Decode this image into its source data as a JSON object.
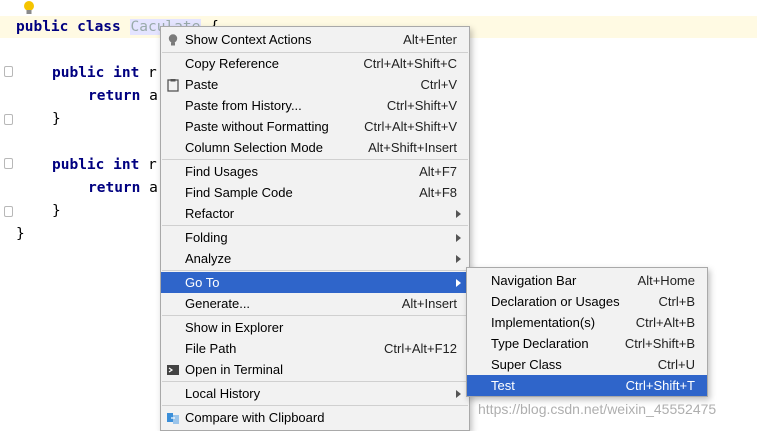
{
  "editor": {
    "lines": [
      {
        "kw": "public class ",
        "name": "Caculate",
        "rest": " {"
      },
      {
        "kw": "public int ",
        "rest": "r"
      },
      {
        "kw": "return ",
        "rest": "a"
      },
      {
        "rest": "}"
      },
      {
        "kw": "public int ",
        "rest": "r"
      },
      {
        "kw": "return ",
        "rest": "a"
      },
      {
        "rest": "}"
      },
      {
        "rest": "}"
      }
    ]
  },
  "context_menu": {
    "items": [
      {
        "label": "Show Context Actions",
        "shortcut": "Alt+Enter",
        "icon": "lightbulb-icon"
      },
      {
        "label": "Copy Reference",
        "shortcut": "Ctrl+Alt+Shift+C"
      },
      {
        "label": "Paste",
        "shortcut": "Ctrl+V",
        "icon": "clipboard-icon"
      },
      {
        "label": "Paste from History...",
        "shortcut": "Ctrl+Shift+V"
      },
      {
        "label": "Paste without Formatting",
        "shortcut": "Ctrl+Alt+Shift+V"
      },
      {
        "label": "Column Selection Mode",
        "shortcut": "Alt+Shift+Insert"
      },
      {
        "label": "Find Usages",
        "shortcut": "Alt+F7"
      },
      {
        "label": "Find Sample Code",
        "shortcut": "Alt+F8"
      },
      {
        "label": "Refactor",
        "shortcut": ""
      },
      {
        "label": "Folding",
        "shortcut": ""
      },
      {
        "label": "Analyze",
        "shortcut": ""
      },
      {
        "label": "Go To",
        "shortcut": ""
      },
      {
        "label": "Generate...",
        "shortcut": "Alt+Insert"
      },
      {
        "label": "Show in Explorer",
        "shortcut": ""
      },
      {
        "label": "File Path",
        "shortcut": "Ctrl+Alt+F12"
      },
      {
        "label": "Open in Terminal",
        "shortcut": "",
        "icon": "terminal-icon"
      },
      {
        "label": "Local History",
        "shortcut": ""
      },
      {
        "label": "Compare with Clipboard",
        "shortcut": "",
        "icon": "compare-icon"
      }
    ]
  },
  "goto_submenu": {
    "items": [
      {
        "label": "Navigation Bar",
        "shortcut": "Alt+Home"
      },
      {
        "label": "Declaration or Usages",
        "shortcut": "Ctrl+B"
      },
      {
        "label": "Implementation(s)",
        "shortcut": "Ctrl+Alt+B"
      },
      {
        "label": "Type Declaration",
        "shortcut": "Ctrl+Shift+B"
      },
      {
        "label": "Super Class",
        "shortcut": "Ctrl+U"
      },
      {
        "label": "Test",
        "shortcut": "Ctrl+Shift+T"
      }
    ]
  },
  "watermark": "https://blog.csdn.net/weixin_45552475",
  "colors": {
    "selection": "#2f65ca",
    "menu_bg": "#f2f2f2",
    "keyword": "#000080"
  }
}
